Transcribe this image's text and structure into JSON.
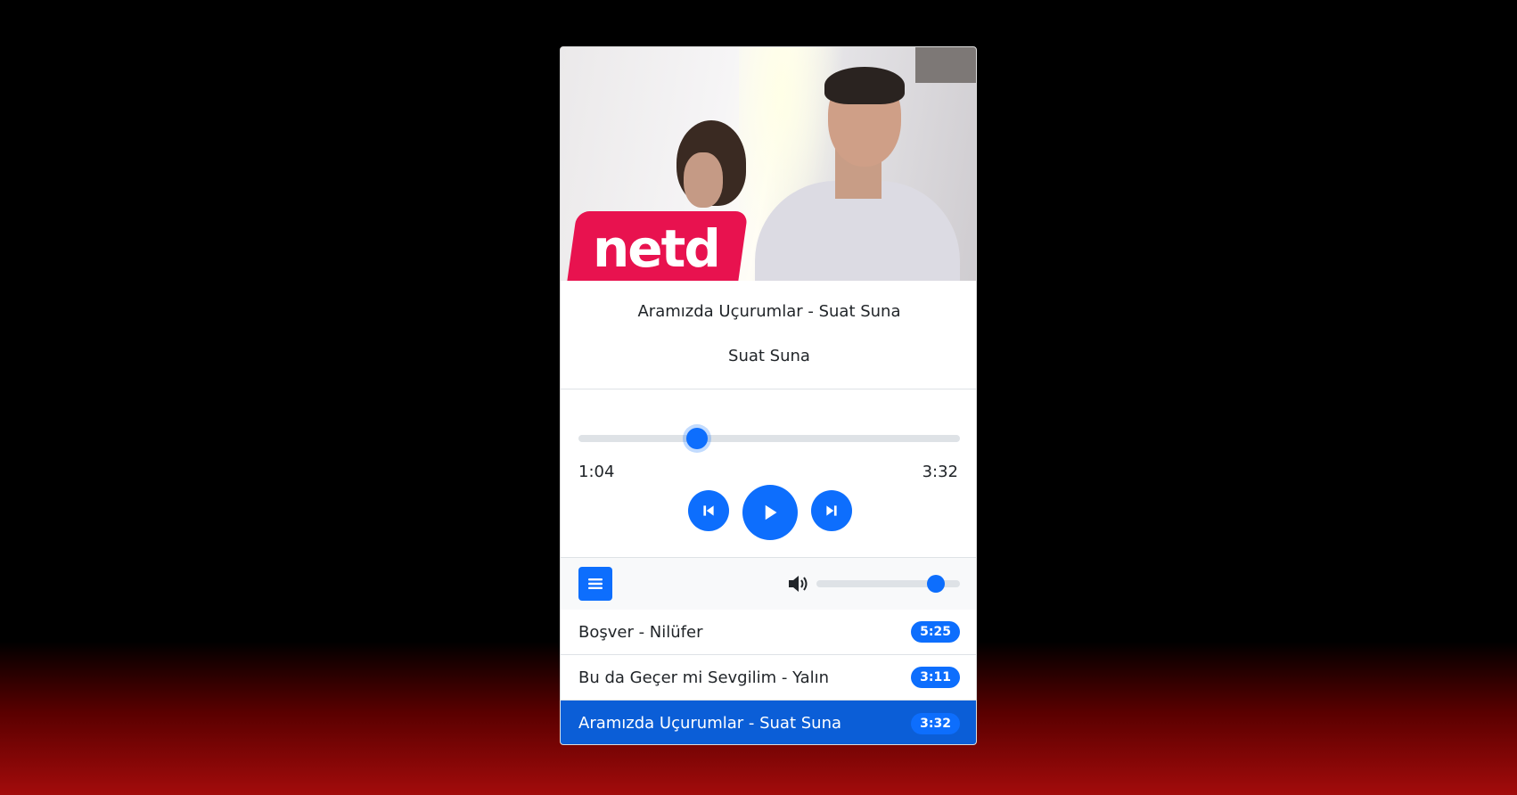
{
  "now_playing": {
    "title": "Aramızda Uçurumlar - Suat Suna",
    "artist": "Suat Suna",
    "cover_logo": "netd",
    "current_time": "1:04",
    "total_time": "3:32",
    "progress_fraction": 0.31
  },
  "controls": {
    "prev_icon": "skip-back-icon",
    "play_icon": "play-icon",
    "next_icon": "skip-forward-icon"
  },
  "volume": {
    "icon": "volume-up-icon",
    "level_fraction": 0.83
  },
  "playlist_button_icon": "list-icon",
  "playlist": [
    {
      "label": "Boşver - Nilüfer",
      "duration": "5:25",
      "active": false
    },
    {
      "label": "Bu da Geçer mi Sevgilim - Yalın",
      "duration": "3:11",
      "active": false
    },
    {
      "label": "Aramızda Uçurumlar - Suat Suna",
      "duration": "3:32",
      "active": true
    }
  ],
  "colors": {
    "accent": "#0d6efd",
    "active_row": "#0b5ed7",
    "badge_brand": "#e8124f"
  }
}
